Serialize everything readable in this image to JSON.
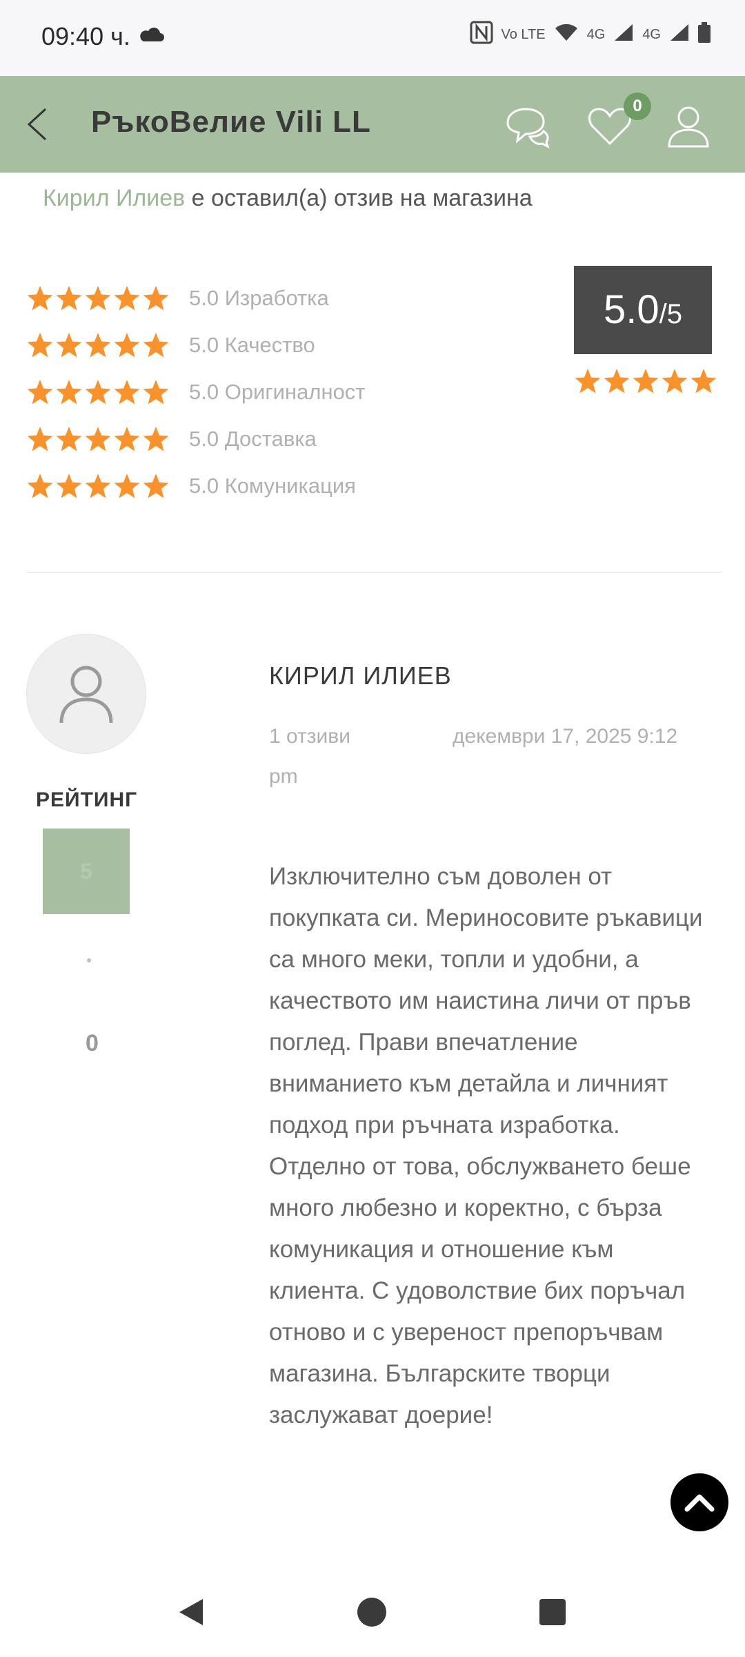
{
  "status_bar": {
    "time": "09:40 ч.",
    "indicators": [
      "N",
      "Vo LTE",
      "4G",
      "4G"
    ]
  },
  "app_bar": {
    "title": "РъкоВелие Vili LL",
    "favorites_count": "0"
  },
  "intro": {
    "name": "Кирил Илиев",
    "text": " е оставил(а) отзив на магазина"
  },
  "ratings": [
    {
      "stars": 5,
      "label": "5.0 Изработка"
    },
    {
      "stars": 5,
      "label": "5.0 Качество"
    },
    {
      "stars": 5,
      "label": "5.0 Оригиналност"
    },
    {
      "stars": 5,
      "label": "5.0 Доставка"
    },
    {
      "stars": 5,
      "label": "5.0 Комуникация"
    }
  ],
  "overall": {
    "score": "5.0",
    "max": "/5",
    "stars": 5
  },
  "review": {
    "rating_label": "РЕЙТИНГ",
    "rating_value": "5",
    "rating_zero": "0",
    "reviewer": "КИРИЛ ИЛИЕВ",
    "reviews_count": "1 отзиви",
    "date": "декември 17, 2025 9:12",
    "date_suffix": "pm",
    "text": "Изключително съм доволен от покупката си. Мериносовите ръкавици са много меки, топли и удобни, а качеството им наистина личи от пръв поглед. Прави впечатление вниманието към детайла и личният подход при ръчната изработка. Отделно от това, обслужването беше много любезно и коректно, с бърза комуникация и отношение към клиента. С удоволствие бих поръчал отново и с увереност препоръчвам магазина. Българските творци заслужават доерие!"
  },
  "colors": {
    "accent": "#a8bea1",
    "star": "#f7922d",
    "badge": "#6e9d63",
    "score_bg": "#4a4a4a"
  },
  "icons": [
    "back-arrow-icon",
    "chat-icon",
    "heart-icon",
    "user-icon",
    "star-icon",
    "chevron-up-icon",
    "avatar-placeholder-icon"
  ]
}
